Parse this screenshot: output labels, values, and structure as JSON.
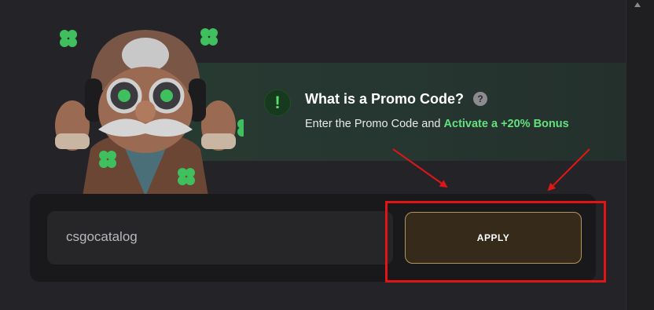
{
  "promo": {
    "title": "What is a Promo Code?",
    "help_icon": "question-mark",
    "alert_icon": "exclamation",
    "description_prefix": "Enter the Promo Code and ",
    "description_highlight": "Activate a +20% Bonus"
  },
  "code_input": {
    "value": "csgocatalog"
  },
  "apply_button": {
    "label": "APPLY"
  },
  "colors": {
    "accent_green": "#66e07f",
    "button_border": "#b6935c",
    "annotation_red": "#e01616",
    "background": "#242428"
  }
}
